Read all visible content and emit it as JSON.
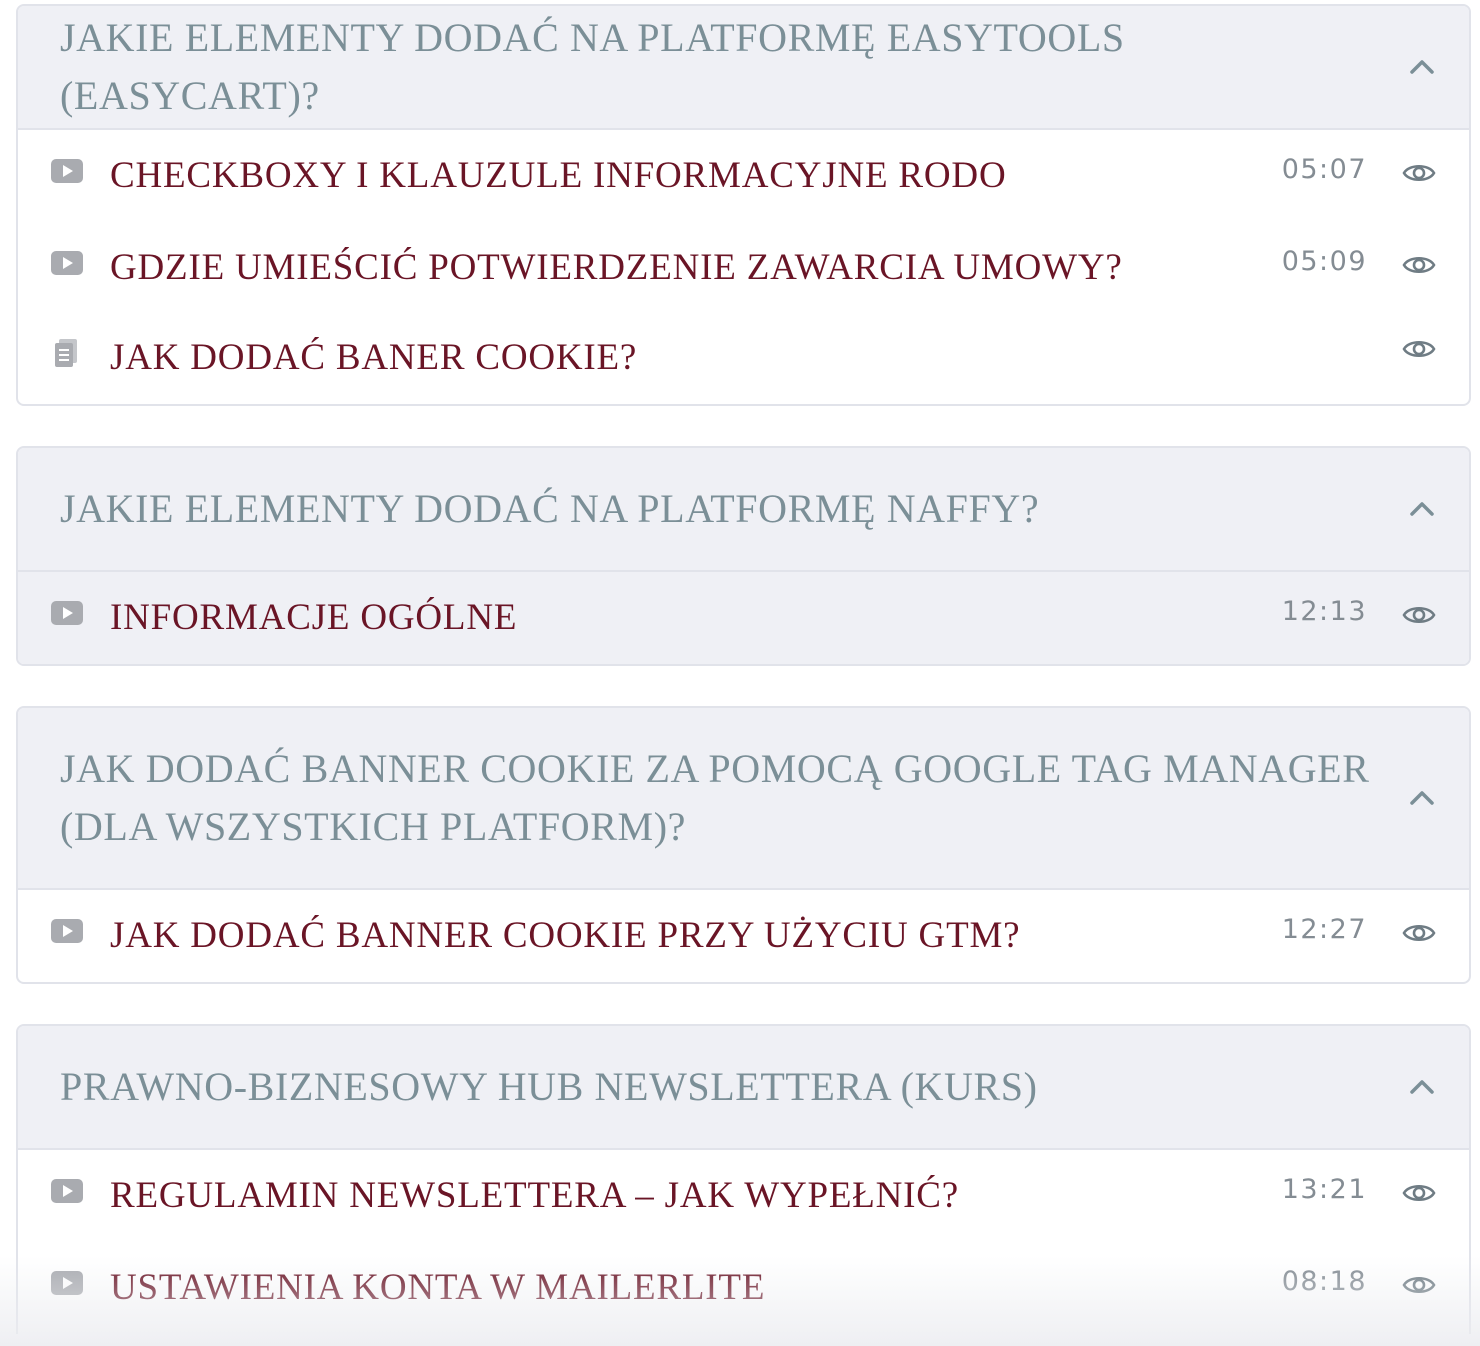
{
  "sections": [
    {
      "title": "JAKIE ELEMENTY DODAĆ NA PLATFORMĘ EASYTOOLS (EASYCART)?",
      "expanded": true,
      "lessons": [
        {
          "type": "video",
          "title": "CHECKBOXY I KLAUZULE INFORMACYJNE RODO",
          "duration": "05:07"
        },
        {
          "type": "video",
          "title": "GDZIE UMIEŚCIĆ POTWIERDZENIE ZAWARCIA UMOWY?",
          "duration": "05:09"
        },
        {
          "type": "text",
          "title": "JAK DODAĆ BANER COOKIE?",
          "duration": ""
        }
      ]
    },
    {
      "title": "JAKIE ELEMENTY DODAĆ NA PLATFORMĘ NAFFY?",
      "expanded": true,
      "lessons": [
        {
          "type": "video",
          "title": "INFORMACJE OGÓLNE",
          "duration": "12:13"
        }
      ]
    },
    {
      "title": "JAK DODAĆ BANNER COOKIE ZA POMOCĄ GOOGLE TAG MANAGER (DLA WSZYSTKICH PLATFORM)?",
      "expanded": true,
      "lessons": [
        {
          "type": "video",
          "title": "JAK DODAĆ BANNER COOKIE PRZY UŻYCIU GTM?",
          "duration": "12:27"
        }
      ]
    },
    {
      "title": "PRAWNO-BIZNESOWY HUB NEWSLETTERA (KURS)",
      "expanded": true,
      "lessons": [
        {
          "type": "video",
          "title": "REGULAMIN NEWSLETTERA – JAK WYPEŁNIĆ?",
          "duration": "13:21"
        },
        {
          "type": "video",
          "title": "USTAWIENIA KONTA W MAILERLITE",
          "duration": "08:18"
        }
      ]
    }
  ],
  "icons": {
    "video": "play-video-icon",
    "text": "document-icon",
    "preview": "eye-icon",
    "toggle": "chevron-up-icon"
  },
  "colors": {
    "header_bg": "#eff0f5",
    "header_text": "#7b8f97",
    "lesson_text": "#6a1526",
    "duration_text": "#848c93",
    "border": "#e1e3ea"
  }
}
